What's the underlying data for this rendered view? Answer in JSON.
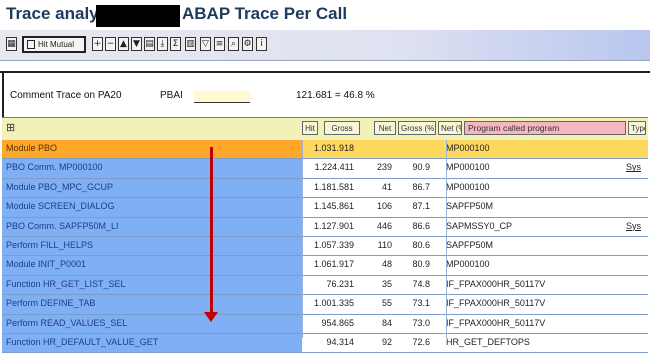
{
  "title": {
    "left": "Trace analysis",
    "right": "ABAP Trace Per Call"
  },
  "toolbar": {
    "button_label": "Hit Mutual"
  },
  "comment": {
    "label": "Comment Trace on PA20",
    "user": "PBAI",
    "value": "121.681 = 46.8 %"
  },
  "header": {
    "col_hit": "Hit",
    "col_gross": "Gross",
    "col_net": "Net",
    "col_gross_pct": "Gross (%)",
    "col_net_pct": "Net (%)",
    "col_program": "Program called program",
    "col_type": "Type"
  },
  "rows": [
    {
      "name": "Module PBO",
      "gross": "1.031.918",
      "net": "",
      "pct": "",
      "prog": "MP000100",
      "type": "",
      "selected": true
    },
    {
      "name": "PBO Comm. MP000100",
      "gross": "1.224.411",
      "net": "239",
      "pct": "90.9",
      "prog": "MP000100",
      "type": "Sys"
    },
    {
      "name": "Module PBO_MPC_GCUP",
      "gross": "1.181.581",
      "net": "41",
      "pct": "86.7",
      "prog": "MP000100",
      "type": ""
    },
    {
      "name": "Module SCREEN_DIALOG",
      "gross": "1.145.861",
      "net": "106",
      "pct": "87.1",
      "prog": "SAPFP50M",
      "type": ""
    },
    {
      "name": "PBO Comm. SAPFP50M_LI",
      "gross": "1.127.901",
      "net": "446",
      "pct": "86.6",
      "prog": "SAPMSSY0_CP",
      "type": "Sys"
    },
    {
      "name": "Perform FILL_HELPS",
      "gross": "1.057.339",
      "net": "110",
      "pct": "80.6",
      "prog": "SAPFP50M",
      "type": ""
    },
    {
      "name": "Module INIT_P0001",
      "gross": "1.061.917",
      "net": "48",
      "pct": "80.9",
      "prog": "MP000100",
      "type": ""
    },
    {
      "name": "Function HR_GET_LIST_SEL",
      "gross": "76.231",
      "net": "35",
      "pct": "74.8",
      "prog": "IF_FPAX000HR_50117V",
      "type": ""
    },
    {
      "name": "Perform DEFINE_TAB",
      "gross": "1.001.335",
      "net": "55",
      "pct": "73.1",
      "prog": "IF_FPAX000HR_50117V",
      "type": ""
    },
    {
      "name": "Perform READ_VALUES_SEL",
      "gross": "954.865",
      "net": "84",
      "pct": "73.0",
      "prog": "IF_FPAX000HR_50117V",
      "type": ""
    },
    {
      "name": "Function HR_DEFAULT_VALUE_GET",
      "gross": "94.314",
      "net": "92",
      "pct": "72.6",
      "prog": "HR_GET_DEFTOPS",
      "type": ""
    }
  ],
  "colors": {
    "selected_row": "#ffa72a",
    "name_col": "#7fb0f5",
    "header": "#f2f1b8",
    "arrow": "#c00000"
  }
}
